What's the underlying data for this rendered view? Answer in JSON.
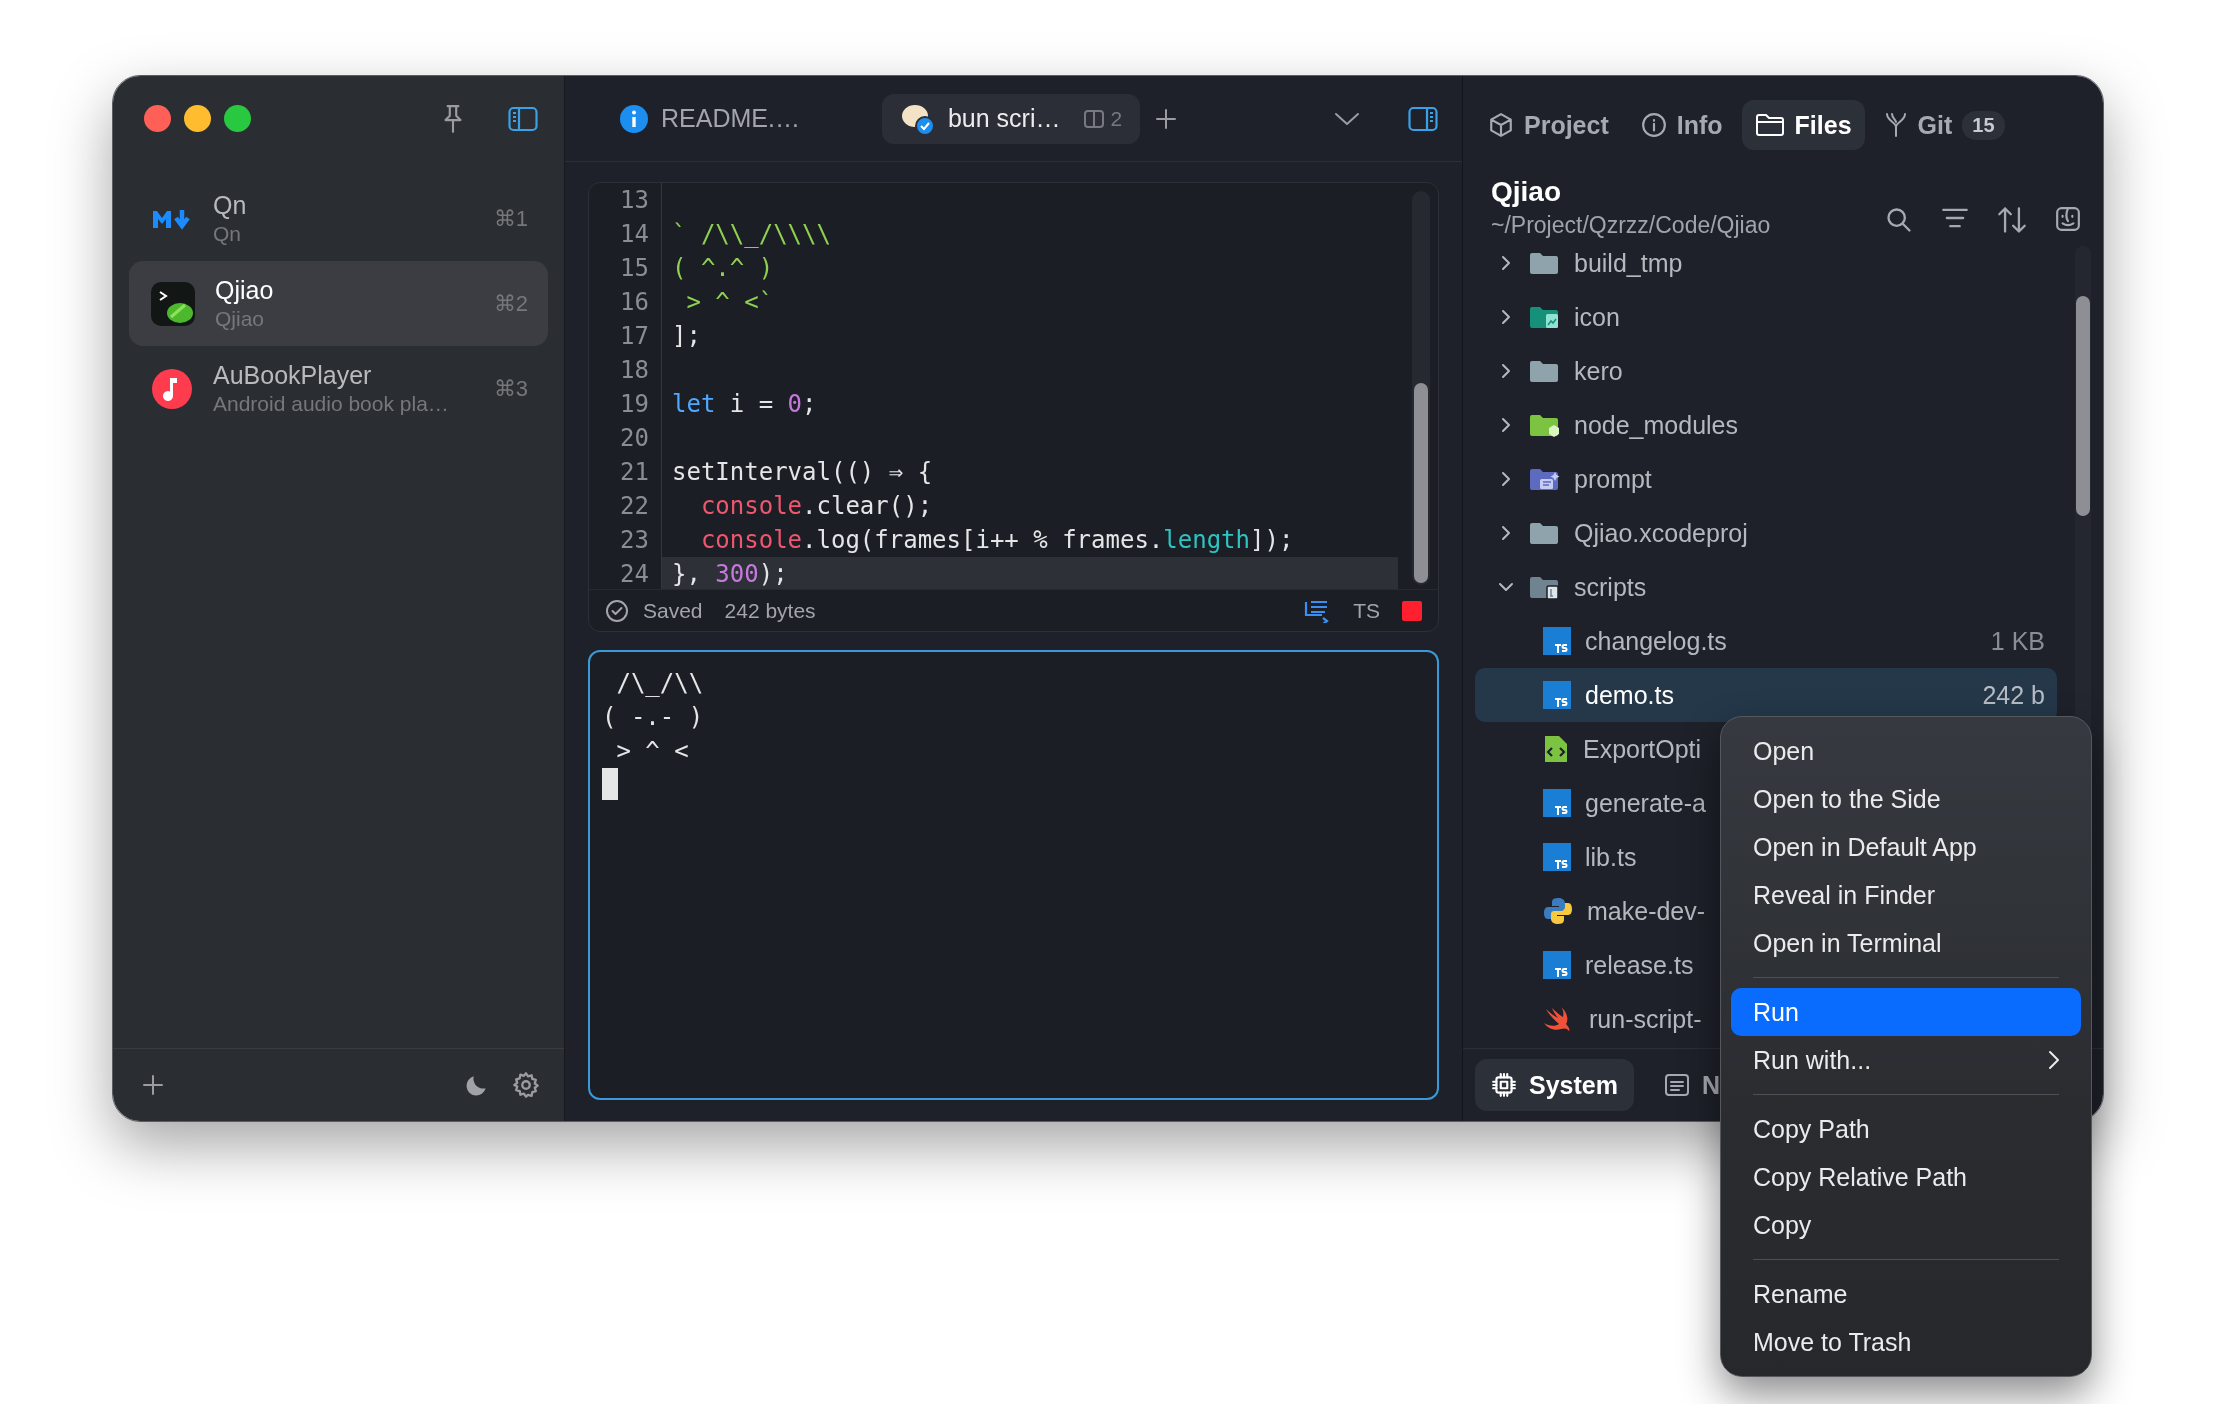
{
  "sidebar": {
    "items": [
      {
        "title": "Qn",
        "subtitle": "Qn",
        "shortcut": "⌘1",
        "kind": "markdown",
        "selected": false
      },
      {
        "title": "Qjiao",
        "subtitle": "Qjiao",
        "shortcut": "⌘2",
        "kind": "terminal",
        "selected": true
      },
      {
        "title": "AuBookPlayer",
        "subtitle": "Android audio book pla…",
        "shortcut": "⌘3",
        "kind": "music",
        "selected": false
      }
    ]
  },
  "editor": {
    "tabs": [
      {
        "label": "README.…",
        "kind": "info",
        "selected": false
      },
      {
        "label": "bun scri…",
        "kind": "script",
        "count": "2",
        "selected": true
      }
    ],
    "lines": [
      {
        "number": "13",
        "current": false
      },
      {
        "number": "14",
        "current": false,
        "tokens": [
          {
            "text": "` /\\\\_/\\\\\\\\",
            "kind": "string"
          }
        ]
      },
      {
        "number": "15",
        "current": false,
        "tokens": [
          {
            "text": "( ^.^ )",
            "kind": "string"
          }
        ]
      },
      {
        "number": "16",
        "current": false,
        "tokens": [
          {
            "text": " > ^ <`",
            "kind": "string"
          }
        ]
      },
      {
        "number": "17",
        "current": false,
        "tokens": [
          {
            "text": "];",
            "kind": "plain"
          }
        ]
      },
      {
        "number": "18",
        "current": false
      },
      {
        "number": "19",
        "current": false,
        "tokens": [
          {
            "text": "let",
            "kind": "keyword"
          },
          {
            "text": " i = ",
            "kind": "plain"
          },
          {
            "text": "0",
            "kind": "number"
          },
          {
            "text": ";",
            "kind": "plain"
          }
        ]
      },
      {
        "number": "20",
        "current": false
      },
      {
        "number": "21",
        "current": false,
        "tokens": [
          {
            "text": "setInterval(() ⇒ {",
            "kind": "plain"
          }
        ]
      },
      {
        "number": "22",
        "current": false,
        "tokens": [
          {
            "text": "  console",
            "kind": "object"
          },
          {
            "text": ".clear();",
            "kind": "plain"
          }
        ]
      },
      {
        "number": "23",
        "current": false,
        "tokens": [
          {
            "text": "  console",
            "kind": "object"
          },
          {
            "text": ".log(frames[i++ % frames.",
            "kind": "plain"
          },
          {
            "text": "length",
            "kind": "property"
          },
          {
            "text": "]);",
            "kind": "plain"
          }
        ]
      },
      {
        "number": "24",
        "current": true,
        "tokens": [
          {
            "text": "}, ",
            "kind": "plain"
          },
          {
            "text": "300",
            "kind": "number"
          },
          {
            "text": ");",
            "kind": "plain"
          }
        ]
      }
    ],
    "status": {
      "state": "Saved",
      "size": "242 bytes",
      "language": "TS",
      "running": true
    },
    "terminal": {
      "lines": [
        " /\\_/\\\\",
        "( -.- )",
        " > ^ <"
      ],
      "cursor": true
    }
  },
  "files": {
    "tabs": [
      {
        "label": "Project",
        "kind": "project",
        "selected": false
      },
      {
        "label": "Info",
        "kind": "info",
        "selected": false
      },
      {
        "label": "Files",
        "kind": "files",
        "selected": true
      },
      {
        "label": "Git",
        "kind": "git",
        "badge": "15",
        "selected": false
      }
    ],
    "title": "Qjiao",
    "path": "~/Project/Qzrzz/Code/Qjiao",
    "tree": [
      {
        "name": "build_tmp",
        "kind": "folder",
        "color": "#8fa3ad",
        "expanded": false,
        "selected": false
      },
      {
        "name": "icon",
        "kind": "folder-image",
        "color": "#17907a",
        "expanded": false,
        "selected": false
      },
      {
        "name": "kero",
        "kind": "folder",
        "color": "#8fa3ad",
        "expanded": false,
        "selected": false
      },
      {
        "name": "node_modules",
        "kind": "folder-node",
        "color": "#7cc342",
        "expanded": false,
        "selected": false
      },
      {
        "name": "prompt",
        "kind": "folder-prompt",
        "color": "#5c6bc0",
        "expanded": false,
        "selected": false
      },
      {
        "name": "Qjiao.xcodeproj",
        "kind": "folder",
        "color": "#8fa3ad",
        "expanded": false,
        "selected": false
      },
      {
        "name": "scripts",
        "kind": "folder-script",
        "color": "#6f8490",
        "expanded": true,
        "selected": false,
        "children": [
          {
            "name": "changelog.ts",
            "kind": "ts",
            "size": "1 KB",
            "selected": false
          },
          {
            "name": "demo.ts",
            "kind": "ts",
            "size": "242 b",
            "selected": true
          },
          {
            "name": "ExportOpti",
            "kind": "xml",
            "selected": false
          },
          {
            "name": "generate-a",
            "kind": "ts",
            "selected": false
          },
          {
            "name": "lib.ts",
            "kind": "ts",
            "selected": false
          },
          {
            "name": "make-dev-",
            "kind": "python",
            "selected": false
          },
          {
            "name": "release.ts",
            "kind": "ts",
            "selected": false
          },
          {
            "name": "run-script-",
            "kind": "swift",
            "selected": false
          }
        ]
      }
    ],
    "bottom_tabs": [
      {
        "label": "System",
        "kind": "system",
        "selected": true
      },
      {
        "label": "N",
        "kind": "notes",
        "selected": false
      }
    ]
  },
  "context_menu": {
    "items": [
      {
        "kind": "item",
        "label": "Open",
        "selected": false,
        "submenu": false
      },
      {
        "kind": "item",
        "label": "Open to the Side",
        "selected": false,
        "submenu": false
      },
      {
        "kind": "item",
        "label": "Open in Default App",
        "selected": false,
        "submenu": false
      },
      {
        "kind": "item",
        "label": "Reveal in Finder",
        "selected": false,
        "submenu": false
      },
      {
        "kind": "item",
        "label": "Open in Terminal",
        "selected": false,
        "submenu": false
      },
      {
        "kind": "separator"
      },
      {
        "kind": "item",
        "label": "Run",
        "selected": true,
        "submenu": false
      },
      {
        "kind": "item",
        "label": "Run with...",
        "selected": false,
        "submenu": true
      },
      {
        "kind": "separator"
      },
      {
        "kind": "item",
        "label": "Copy Path",
        "selected": false,
        "submenu": false
      },
      {
        "kind": "item",
        "label": "Copy Relative Path",
        "selected": false,
        "submenu": false
      },
      {
        "kind": "item",
        "label": "Copy",
        "selected": false,
        "submenu": false
      },
      {
        "kind": "separator"
      },
      {
        "kind": "item",
        "label": "Rename",
        "selected": false,
        "submenu": false
      },
      {
        "kind": "item",
        "label": "Move to Trash",
        "selected": false,
        "submenu": false
      }
    ]
  }
}
